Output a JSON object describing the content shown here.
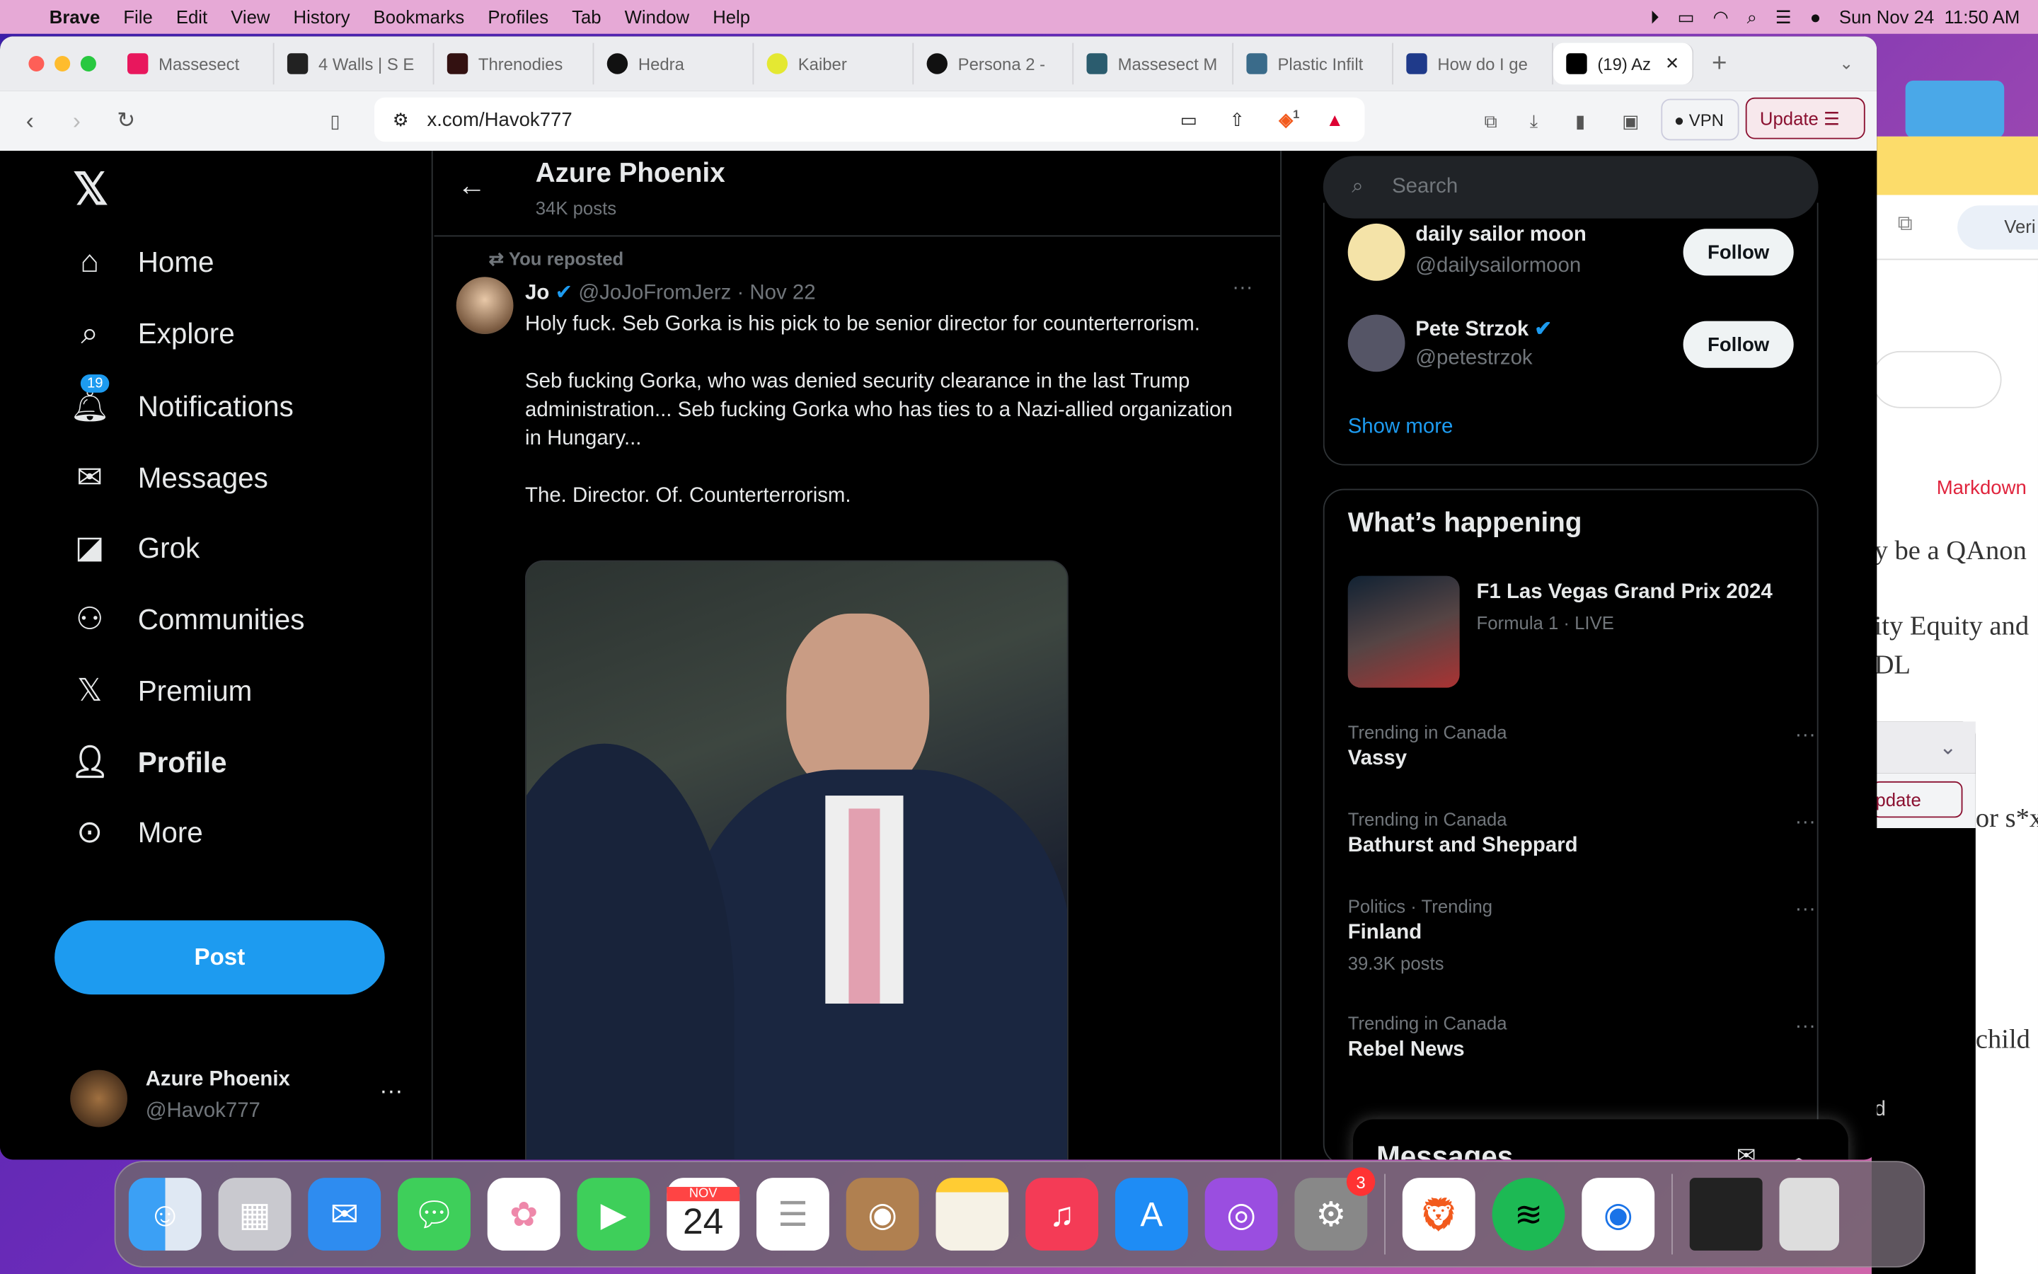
{
  "menubar": {
    "app": "Brave",
    "items": [
      "File",
      "Edit",
      "View",
      "History",
      "Bookmarks",
      "Profiles",
      "Tab",
      "Window",
      "Help"
    ],
    "datetime": "Sun Nov 24  11:50 AM"
  },
  "browser": {
    "tabs": [
      {
        "label": "Massesect",
        "color": "#e8175d"
      },
      {
        "label": "4 Walls | S E",
        "color": "#222"
      },
      {
        "label": "Threnodies",
        "color": "#311"
      },
      {
        "label": "Hedra",
        "color": "#111"
      },
      {
        "label": "Kaiber",
        "color": "#e4e832"
      },
      {
        "label": "Persona 2 -",
        "color": "#111"
      },
      {
        "label": "Massesect M",
        "color": "#2b5c6e"
      },
      {
        "label": "Plastic Infilt",
        "color": "#3a6b8a"
      },
      {
        "label": "How do I ge",
        "color": "#1f3a8a"
      },
      {
        "label": "(19) Az",
        "color": "#000",
        "active": true
      }
    ],
    "url": "x.com/Havok777",
    "shields_count": "1",
    "vpn_label": "VPN",
    "update_label": "Update"
  },
  "x": {
    "nav": [
      {
        "label": "Home",
        "icon": "home-icon"
      },
      {
        "label": "Explore",
        "icon": "search-icon"
      },
      {
        "label": "Notifications",
        "icon": "bell-icon",
        "badge": "19"
      },
      {
        "label": "Messages",
        "icon": "mail-icon"
      },
      {
        "label": "Grok",
        "icon": "grok-icon"
      },
      {
        "label": "Communities",
        "icon": "communities-icon"
      },
      {
        "label": "Premium",
        "icon": "x-logo-icon"
      },
      {
        "label": "Profile",
        "icon": "person-icon"
      },
      {
        "label": "More",
        "icon": "more-circle-icon"
      }
    ],
    "post_label": "Post",
    "account": {
      "name": "Azure Phoenix",
      "handle": "@Havok777"
    },
    "header": {
      "title": "Azure Phoenix",
      "subtitle": "34K posts"
    },
    "tweet": {
      "repost_label": "You reposted",
      "author": "Jo",
      "handle": "@JoJoFromJerz",
      "date": "· Nov 22",
      "paragraphs": [
        "Holy fuck. Seb Gorka is his pick to be senior director for counterterrorism.",
        "Seb fucking Gorka, who was denied security clearance in the last Trump administration... Seb fucking Gorka who has ties to a Nazi-allied organization in Hungary...",
        "The. Director. Of. Counterterrorism."
      ]
    },
    "search_placeholder": "Search",
    "who_to_follow": [
      {
        "name": "daily sailor moon",
        "handle": "@dailysailormoon",
        "verified": false
      },
      {
        "name": "Pete Strzok",
        "handle": "@petestrzok",
        "verified": true
      }
    ],
    "follow_label": "Follow",
    "show_more": "Show more",
    "happening": {
      "title": "What’s happening",
      "featured": {
        "title": "F1 Las Vegas Grand Prix 2024",
        "meta": "Formula 1 · LIVE"
      },
      "trends": [
        {
          "context": "Trending in Canada",
          "topic": "Vassy"
        },
        {
          "context": "Trending in Canada",
          "topic": "Bathurst and Sheppard"
        },
        {
          "context": "Politics · Trending",
          "topic": "Finland",
          "posts": "39.3K posts"
        },
        {
          "context": "Trending in Canada",
          "topic": "Rebel News"
        }
      ]
    },
    "messages_drawer": "Messages"
  },
  "background_window": {
    "extension_label": "Veri",
    "tab": "Markdown",
    "lines": [
      "y be a QAnon",
      "ity Equity and",
      "DL",
      "or s*x",
      "child",
      "d"
    ],
    "update_label": "pdate"
  },
  "dock": {
    "calendar_month": "NOV",
    "calendar_day": "24",
    "settings_badge": "3"
  }
}
